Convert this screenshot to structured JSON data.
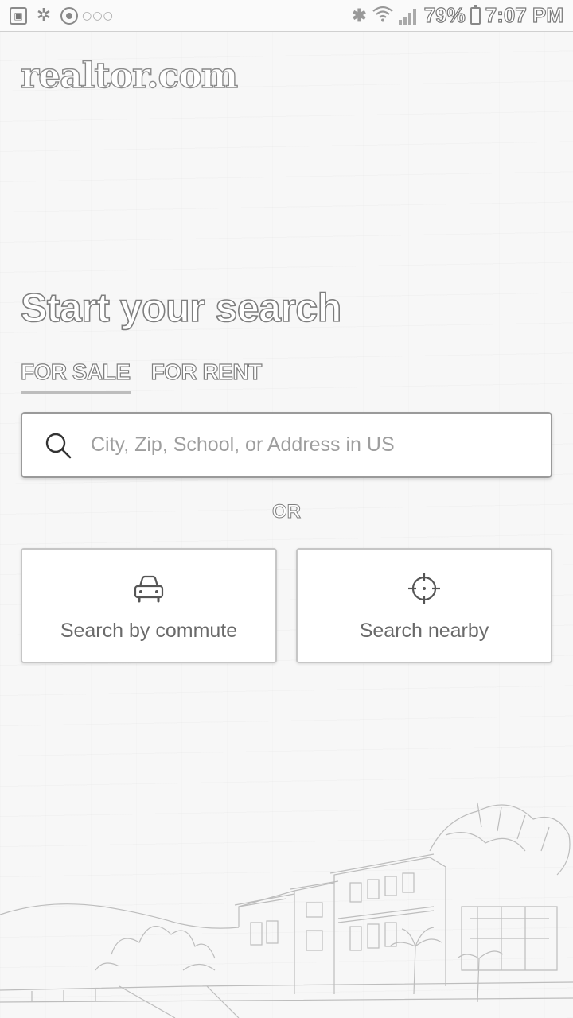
{
  "status_bar": {
    "battery": "79%",
    "time": "7:07 PM",
    "left_icons": [
      "photo-icon",
      "fan-icon",
      "target-icon",
      "more-dots-icon"
    ],
    "right_icons": [
      "bluetooth-icon",
      "wifi-icon",
      "signal-icon",
      "battery-icon"
    ]
  },
  "brand": {
    "logo": "realtor.com"
  },
  "hero": {
    "title": "Start your search"
  },
  "tabs": [
    {
      "label": "FOR SALE",
      "active": true
    },
    {
      "label": "FOR RENT",
      "active": false
    }
  ],
  "search": {
    "placeholder": "City, Zip, School, or Address in US",
    "value": "",
    "icon": "search-icon"
  },
  "divider": {
    "or_label": "OR"
  },
  "options": [
    {
      "label": "Search by commute",
      "icon": "car-icon"
    },
    {
      "label": "Search nearby",
      "icon": "crosshair-icon"
    }
  ],
  "colors": {
    "background": "#f6f6f6",
    "card_background": "#ffffff",
    "text_outline": "#7e7e7e",
    "muted_text": "#6a6a6a",
    "placeholder": "#9e9e9e"
  }
}
